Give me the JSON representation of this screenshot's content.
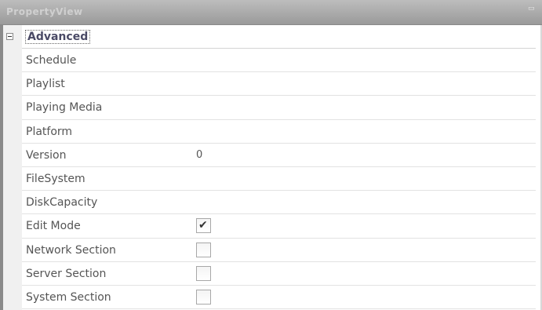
{
  "window": {
    "title": "PropertyView"
  },
  "grid": {
    "category": {
      "label": "Advanced",
      "expanded": true
    },
    "rows": [
      {
        "name": "Schedule",
        "value": ""
      },
      {
        "name": "Playlist",
        "value": ""
      },
      {
        "name": "Playing Media",
        "value": ""
      },
      {
        "name": "Platform",
        "value": ""
      },
      {
        "name": "Version",
        "value": "0"
      },
      {
        "name": "FileSystem",
        "value": ""
      },
      {
        "name": "DiskCapacity",
        "value": ""
      },
      {
        "name": "Edit Mode",
        "checked": true
      },
      {
        "name": "Network Section",
        "checked": false
      },
      {
        "name": "Server Section",
        "checked": false
      },
      {
        "name": "System Section",
        "checked": false
      }
    ]
  },
  "icons": {
    "collapse": "minus-box-icon",
    "check": "checkmark-icon"
  }
}
